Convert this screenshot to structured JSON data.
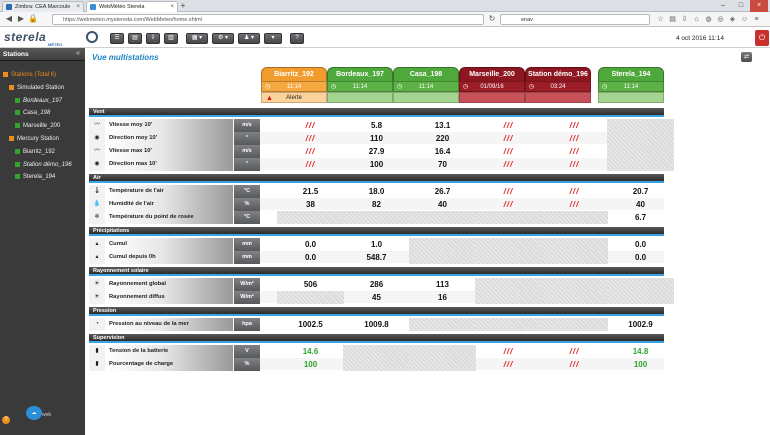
{
  "browser": {
    "tabs": [
      {
        "title": "Zimbra: CEA Marcoule",
        "color": "#2b6cb7"
      },
      {
        "title": "WebMétéo Sterela",
        "color": "#3a8ed6"
      }
    ],
    "url": "https://webmeteo.mystereda.com/WebMeteo/home.xhtml",
    "search": "enav"
  },
  "app": {
    "logo": "sterela",
    "logo_sub": "MÉTÉO",
    "datetime": "4 oct 2016 11:14",
    "toolbar": [
      "☰",
      "▤",
      "⇩",
      "▥",
      "▦ ▾",
      "⚙ ▾",
      "♟ ▾",
      "▾",
      "?"
    ]
  },
  "sidebar": {
    "title": "Stations",
    "items": [
      {
        "label": "Stations (Total 6)",
        "level": 0,
        "icon": "org",
        "selected": true
      },
      {
        "label": "Simulated Station",
        "level": 1,
        "icon": "org"
      },
      {
        "label": "Bordeaux_197",
        "level": 2,
        "icon": "grn",
        "italic": true
      },
      {
        "label": "Casa_198",
        "level": 2,
        "icon": "grn",
        "italic": true
      },
      {
        "label": "Marseille_200",
        "level": 2,
        "icon": "grn"
      },
      {
        "label": "Mercury Station",
        "level": 1,
        "icon": "org"
      },
      {
        "label": "Biarritz_192",
        "level": 2,
        "icon": "grn"
      },
      {
        "label": "Station démo_196",
        "level": 2,
        "icon": "grn",
        "italic": true
      },
      {
        "label": "Sterela_194",
        "level": 2,
        "icon": "grn"
      }
    ],
    "footer": "web"
  },
  "main": {
    "title": "Vue multistations",
    "stations": [
      {
        "name": "Biarritz_192",
        "time": "11:14",
        "alert": "Alerte",
        "status": "orange",
        "hdr": "#f39c2e",
        "tmbg": "#f6a940",
        "albg": "#fbd29a"
      },
      {
        "name": "Bordeaux_197",
        "time": "11:14",
        "alert": "",
        "status": "green",
        "hdr": "#4fa83b",
        "tmbg": "#5cb246",
        "albg": "#a4d48f"
      },
      {
        "name": "Casa_198",
        "time": "11:14",
        "alert": "",
        "status": "green",
        "hdr": "#4fa83b",
        "tmbg": "#5cb246",
        "albg": "#a4d48f"
      },
      {
        "name": "Marseille_200",
        "time": "01/09/16",
        "alert": "",
        "status": "red",
        "hdr": "#8e1620",
        "tmbg": "#9d1d27",
        "albg": "#c7525a"
      },
      {
        "name": "Station démo_196",
        "time": "03:24",
        "alert": "",
        "status": "red",
        "hdr": "#8e1620",
        "tmbg": "#9d1d27",
        "albg": "#c7525a"
      },
      {
        "name": "Sterela_194",
        "time": "11:14",
        "alert": "",
        "status": "green",
        "hdr": "#4fa83b",
        "tmbg": "#5cb246",
        "albg": "#a4d48f"
      }
    ],
    "sections": [
      {
        "title": "Vent",
        "rows": [
          {
            "icon": "wind-icon",
            "glyph": "〰",
            "label": "Vitesse moy 10'",
            "unit": "m/s",
            "values": [
              "///",
              "5.8",
              "13.1",
              "///",
              "///",
              ""
            ]
          },
          {
            "icon": "direction-icon",
            "glyph": "◉",
            "label": "Direction moy 10'",
            "unit": "°",
            "values": [
              "///",
              "110",
              "220",
              "///",
              "///",
              ""
            ]
          },
          {
            "icon": "wind-icon",
            "glyph": "〰",
            "label": "Vitesse max 10'",
            "unit": "m/s",
            "values": [
              "///",
              "27.9",
              "16.4",
              "///",
              "///",
              ""
            ]
          },
          {
            "icon": "direction-icon",
            "glyph": "◉",
            "label": "Direction max 10'",
            "unit": "°",
            "values": [
              "///",
              "100",
              "70",
              "///",
              "///",
              ""
            ]
          }
        ]
      },
      {
        "title": "Air",
        "rows": [
          {
            "icon": "thermometer-icon",
            "glyph": "🌡",
            "label": "Température de l'air",
            "unit": "°C",
            "values": [
              "21.5",
              "18.0",
              "26.7",
              "///",
              "///",
              "20.7"
            ]
          },
          {
            "icon": "humidity-icon",
            "glyph": "💧",
            "label": "Humidité de l'air",
            "unit": "%",
            "values": [
              "38",
              "82",
              "40",
              "///",
              "///",
              "40"
            ]
          },
          {
            "icon": "dewpoint-icon",
            "glyph": "❄",
            "label": "Température du point de rosée",
            "unit": "°C",
            "values": [
              "",
              "",
              "",
              "",
              "",
              "6.7"
            ]
          }
        ]
      },
      {
        "title": "Précipitations",
        "rows": [
          {
            "icon": "rain-icon",
            "glyph": "▴",
            "label": "Cumul",
            "unit": "mm",
            "values": [
              "0.0",
              "1.0",
              "",
              "",
              "",
              "0.0"
            ]
          },
          {
            "icon": "rain-icon",
            "glyph": "▴",
            "label": "Cumul depuis 0h",
            "unit": "mm",
            "values": [
              "0.0",
              "548.7",
              "",
              "",
              "",
              "0.0"
            ]
          }
        ]
      },
      {
        "title": "Rayonnement solaire",
        "rows": [
          {
            "icon": "sun-icon",
            "glyph": "☀",
            "label": "Rayonnement global",
            "unit": "W/m²",
            "values": [
              "506",
              "286",
              "113",
              "",
              "",
              ""
            ]
          },
          {
            "icon": "sun-icon",
            "glyph": "☀",
            "label": "Rayonnement diffus",
            "unit": "W/m²",
            "values": [
              "",
              "45",
              "16",
              "",
              "",
              ""
            ]
          }
        ]
      },
      {
        "title": "Pression",
        "rows": [
          {
            "icon": "pressure-icon",
            "glyph": "◔",
            "label": "Pression au niveau de la mer",
            "unit": "hpa",
            "values": [
              "1002.5",
              "1009.8",
              "",
              "",
              "",
              "1002.9"
            ]
          }
        ]
      },
      {
        "title": "Supervision",
        "rows": [
          {
            "icon": "battery-icon",
            "glyph": "▮",
            "label": "Tension de la batterie",
            "unit": "V",
            "values": [
              "14.6",
              "",
              "",
              "///",
              "///",
              "14.8"
            ]
          },
          {
            "icon": "battery-icon",
            "glyph": "▮",
            "label": "Pourcentage de charge",
            "unit": "%",
            "values": [
              "100",
              "",
              "",
              "///",
              "///",
              "100"
            ]
          }
        ]
      }
    ]
  }
}
